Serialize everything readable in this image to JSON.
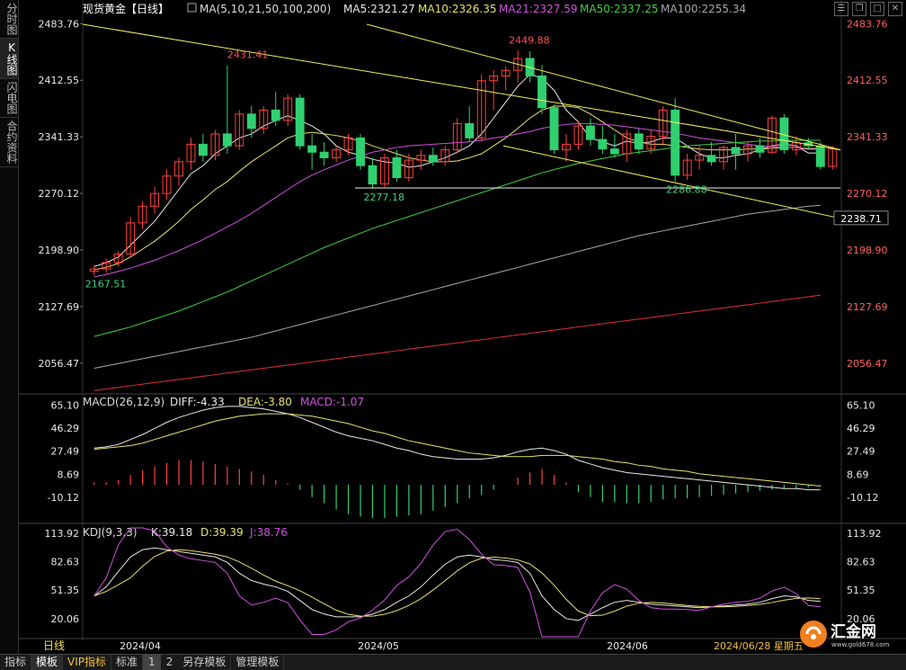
{
  "sidebar": {
    "tabs": [
      "分时图",
      "K线图",
      "闪电图",
      "合约资料"
    ],
    "active": 1
  },
  "header": {
    "title": "现货黄金【日线】",
    "lock_icon": "lock-icon"
  },
  "ma_legend": [
    {
      "label": "MA(5,10,21,50,100,200)",
      "color": "#dddddd"
    },
    {
      "label": "MA5:2321.27",
      "color": "#e8e8e8"
    },
    {
      "label": "MA10:2326.35",
      "color": "#e8e070"
    },
    {
      "label": "MA21:2327.59",
      "color": "#d050e0"
    },
    {
      "label": "MA50:2337.25",
      "color": "#40d040"
    },
    {
      "label": "MA100:2255.34",
      "color": "#a8a8a8"
    }
  ],
  "macd_legend": [
    {
      "label": "MACD(26,12,9)",
      "color": "#dddddd"
    },
    {
      "label": "DIFF:-4.33",
      "color": "#e8e8e8"
    },
    {
      "label": "DEA:-3.80",
      "color": "#e8e070"
    },
    {
      "label": "MACD:-1.07",
      "color": "#d050e0"
    }
  ],
  "kdj_legend": [
    {
      "label": "KDJ(9,3,3)",
      "color": "#dddddd"
    },
    {
      "label": "K:39.18",
      "color": "#e8e8e8"
    },
    {
      "label": "D:39.39",
      "color": "#e8e070"
    },
    {
      "label": "J:38.76",
      "color": "#d050e0"
    }
  ],
  "bottom_bar": {
    "period": "日线",
    "items": [
      "指标",
      "模板",
      "VIP指标",
      "标准",
      "1",
      "2",
      "另存模板",
      "管理模板"
    ]
  },
  "logo": {
    "name": "汇金网",
    "url": "www.gold678.com"
  },
  "chart_data": {
    "type": "candlestick",
    "price_ticks": [
      "2483.76",
      "2412.55",
      "2341.33",
      "2270.12",
      "2198.90",
      "2127.69",
      "2056.47"
    ],
    "price_range": [
      2020.0,
      2500.0
    ],
    "trendline_label": "2238.71",
    "x_labels": [
      "2024/04",
      "2024/05",
      "2024/06"
    ],
    "cursor_date": "2024/06/28 星期五",
    "annotations": [
      {
        "text": "2483.76",
        "color": "#dddddd"
      },
      {
        "text": "2431.41",
        "color": "#ff5050"
      },
      {
        "text": "2449.88",
        "color": "#ff5050"
      },
      {
        "text": "2167.51",
        "color": "#40d080"
      },
      {
        "text": "2277.18",
        "color": "#40d080"
      },
      {
        "text": "2286.88",
        "color": "#40d080"
      }
    ],
    "candles": [
      {
        "o": 2172,
        "h": 2180,
        "l": 2167,
        "c": 2175
      },
      {
        "o": 2175,
        "h": 2188,
        "l": 2170,
        "c": 2183
      },
      {
        "o": 2183,
        "h": 2198,
        "l": 2178,
        "c": 2194
      },
      {
        "o": 2194,
        "h": 2240,
        "l": 2190,
        "c": 2233
      },
      {
        "o": 2233,
        "h": 2260,
        "l": 2225,
        "c": 2254
      },
      {
        "o": 2254,
        "h": 2278,
        "l": 2245,
        "c": 2270
      },
      {
        "o": 2270,
        "h": 2300,
        "l": 2262,
        "c": 2292
      },
      {
        "o": 2292,
        "h": 2315,
        "l": 2280,
        "c": 2310
      },
      {
        "o": 2310,
        "h": 2340,
        "l": 2300,
        "c": 2332
      },
      {
        "o": 2332,
        "h": 2345,
        "l": 2310,
        "c": 2318
      },
      {
        "o": 2318,
        "h": 2350,
        "l": 2312,
        "c": 2345
      },
      {
        "o": 2345,
        "h": 2431,
        "l": 2320,
        "c": 2330
      },
      {
        "o": 2330,
        "h": 2375,
        "l": 2325,
        "c": 2370
      },
      {
        "o": 2370,
        "h": 2380,
        "l": 2340,
        "c": 2352
      },
      {
        "o": 2352,
        "h": 2380,
        "l": 2345,
        "c": 2375
      },
      {
        "o": 2375,
        "h": 2398,
        "l": 2355,
        "c": 2362
      },
      {
        "o": 2362,
        "h": 2395,
        "l": 2355,
        "c": 2390
      },
      {
        "o": 2390,
        "h": 2395,
        "l": 2325,
        "c": 2330
      },
      {
        "o": 2330,
        "h": 2345,
        "l": 2300,
        "c": 2322
      },
      {
        "o": 2322,
        "h": 2335,
        "l": 2305,
        "c": 2315
      },
      {
        "o": 2315,
        "h": 2330,
        "l": 2310,
        "c": 2325
      },
      {
        "o": 2325,
        "h": 2345,
        "l": 2318,
        "c": 2340
      },
      {
        "o": 2340,
        "h": 2345,
        "l": 2300,
        "c": 2305
      },
      {
        "o": 2305,
        "h": 2315,
        "l": 2277,
        "c": 2282
      },
      {
        "o": 2282,
        "h": 2320,
        "l": 2278,
        "c": 2315
      },
      {
        "o": 2315,
        "h": 2325,
        "l": 2285,
        "c": 2290
      },
      {
        "o": 2290,
        "h": 2320,
        "l": 2285,
        "c": 2312
      },
      {
        "o": 2312,
        "h": 2325,
        "l": 2300,
        "c": 2318
      },
      {
        "o": 2318,
        "h": 2328,
        "l": 2305,
        "c": 2310
      },
      {
        "o": 2310,
        "h": 2330,
        "l": 2305,
        "c": 2325
      },
      {
        "o": 2325,
        "h": 2365,
        "l": 2320,
        "c": 2358
      },
      {
        "o": 2358,
        "h": 2380,
        "l": 2335,
        "c": 2340
      },
      {
        "o": 2340,
        "h": 2420,
        "l": 2335,
        "c": 2412
      },
      {
        "o": 2412,
        "h": 2425,
        "l": 2375,
        "c": 2418
      },
      {
        "o": 2418,
        "h": 2430,
        "l": 2400,
        "c": 2425
      },
      {
        "o": 2425,
        "h": 2450,
        "l": 2410,
        "c": 2440
      },
      {
        "o": 2440,
        "h": 2449,
        "l": 2410,
        "c": 2418
      },
      {
        "o": 2418,
        "h": 2432,
        "l": 2370,
        "c": 2378
      },
      {
        "o": 2378,
        "h": 2382,
        "l": 2320,
        "c": 2325
      },
      {
        "o": 2325,
        "h": 2345,
        "l": 2310,
        "c": 2332
      },
      {
        "o": 2332,
        "h": 2360,
        "l": 2325,
        "c": 2355
      },
      {
        "o": 2355,
        "h": 2365,
        "l": 2330,
        "c": 2338
      },
      {
        "o": 2338,
        "h": 2355,
        "l": 2320,
        "c": 2326
      },
      {
        "o": 2326,
        "h": 2345,
        "l": 2315,
        "c": 2320
      },
      {
        "o": 2320,
        "h": 2350,
        "l": 2310,
        "c": 2345
      },
      {
        "o": 2345,
        "h": 2352,
        "l": 2320,
        "c": 2326
      },
      {
        "o": 2326,
        "h": 2350,
        "l": 2320,
        "c": 2342
      },
      {
        "o": 2342,
        "h": 2380,
        "l": 2330,
        "c": 2375
      },
      {
        "o": 2375,
        "h": 2390,
        "l": 2285,
        "c": 2293
      },
      {
        "o": 2293,
        "h": 2320,
        "l": 2287,
        "c": 2312
      },
      {
        "o": 2312,
        "h": 2330,
        "l": 2300,
        "c": 2318
      },
      {
        "o": 2318,
        "h": 2335,
        "l": 2305,
        "c": 2310
      },
      {
        "o": 2310,
        "h": 2330,
        "l": 2300,
        "c": 2328
      },
      {
        "o": 2328,
        "h": 2345,
        "l": 2300,
        "c": 2320
      },
      {
        "o": 2320,
        "h": 2335,
        "l": 2310,
        "c": 2330
      },
      {
        "o": 2330,
        "h": 2340,
        "l": 2315,
        "c": 2322
      },
      {
        "o": 2322,
        "h": 2368,
        "l": 2320,
        "c": 2365
      },
      {
        "o": 2365,
        "h": 2370,
        "l": 2320,
        "c": 2325
      },
      {
        "o": 2325,
        "h": 2342,
        "l": 2318,
        "c": 2334
      },
      {
        "o": 2334,
        "h": 2340,
        "l": 2325,
        "c": 2330
      },
      {
        "o": 2330,
        "h": 2335,
        "l": 2300,
        "c": 2304
      },
      {
        "o": 2304,
        "h": 2330,
        "l": 2300,
        "c": 2326
      }
    ],
    "ma_lines": [
      {
        "name": "MA5",
        "color": "#e8e8e8",
        "values": [
          2178,
          2183,
          2190,
          2205,
          2220,
          2235,
          2255,
          2275,
          2295,
          2305,
          2320,
          2330,
          2340,
          2345,
          2355,
          2362,
          2368,
          2362,
          2355,
          2345,
          2330,
          2322,
          2318,
          2313,
          2310,
          2308,
          2303,
          2305,
          2310,
          2315,
          2322,
          2330,
          2345,
          2365,
          2385,
          2405,
          2420,
          2415,
          2400,
          2375,
          2360,
          2340,
          2335,
          2330,
          2336,
          2333,
          2335,
          2340,
          2340,
          2330,
          2320,
          2315,
          2315,
          2318,
          2320,
          2325,
          2330,
          2332,
          2330,
          2321,
          2321
        ]
      },
      {
        "name": "MA10",
        "color": "#e8e070",
        "values": [
          2174,
          2177,
          2182,
          2190,
          2200,
          2210,
          2222,
          2235,
          2250,
          2262,
          2275,
          2285,
          2298,
          2310,
          2320,
          2330,
          2340,
          2345,
          2347,
          2345,
          2343,
          2340,
          2336,
          2330,
          2325,
          2320,
          2315,
          2312,
          2310,
          2310,
          2311,
          2315,
          2320,
          2330,
          2340,
          2352,
          2365,
          2375,
          2380,
          2380,
          2378,
          2370,
          2360,
          2350,
          2340,
          2335,
          2332,
          2332,
          2330,
          2328,
          2326,
          2325,
          2325,
          2325,
          2326,
          2326,
          2327,
          2328,
          2328,
          2326,
          2326
        ]
      },
      {
        "name": "MA21",
        "color": "#d050e0",
        "values": [
          2165,
          2168,
          2172,
          2176,
          2181,
          2186,
          2192,
          2198,
          2205,
          2212,
          2220,
          2228,
          2236,
          2245,
          2255,
          2265,
          2275,
          2285,
          2293,
          2300,
          2306,
          2312,
          2317,
          2322,
          2325,
          2328,
          2330,
          2331,
          2332,
          2333,
          2334,
          2335,
          2337,
          2340,
          2342,
          2345,
          2348,
          2352,
          2355,
          2357,
          2358,
          2358,
          2357,
          2356,
          2354,
          2352,
          2350,
          2348,
          2346,
          2343,
          2340,
          2338,
          2336,
          2334,
          2332,
          2330,
          2329,
          2328,
          2328,
          2327,
          2327
        ]
      },
      {
        "name": "MA50",
        "color": "#40d040",
        "values": [
          2090,
          2094,
          2098,
          2102,
          2107,
          2112,
          2117,
          2122,
          2128,
          2134,
          2140,
          2146,
          2153,
          2160,
          2167,
          2174,
          2181,
          2188,
          2195,
          2202,
          2208,
          2214,
          2220,
          2226,
          2231,
          2236,
          2241,
          2246,
          2251,
          2256,
          2261,
          2266,
          2271,
          2276,
          2281,
          2286,
          2291,
          2296,
          2300,
          2304,
          2308,
          2311,
          2314,
          2317,
          2320,
          2322,
          2324,
          2326,
          2328,
          2330,
          2331,
          2332,
          2333,
          2334,
          2335,
          2336,
          2336,
          2337,
          2337,
          2337,
          2337
        ]
      },
      {
        "name": "MA100",
        "color": "#a8a8a8",
        "values": [
          2050,
          2053,
          2056,
          2059,
          2062,
          2065,
          2068,
          2071,
          2074,
          2077,
          2080,
          2083,
          2086,
          2089,
          2093,
          2097,
          2101,
          2105,
          2109,
          2113,
          2117,
          2121,
          2125,
          2129,
          2133,
          2137,
          2141,
          2145,
          2149,
          2153,
          2157,
          2161,
          2165,
          2169,
          2173,
          2177,
          2181,
          2185,
          2189,
          2193,
          2197,
          2201,
          2205,
          2209,
          2213,
          2217,
          2220,
          2223,
          2226,
          2229,
          2232,
          2235,
          2238,
          2241,
          2244,
          2246,
          2248,
          2250,
          2252,
          2254,
          2255
        ]
      },
      {
        "name": "MA200",
        "color": "#e03030",
        "values": [
          2022,
          2024,
          2026,
          2028,
          2030,
          2032,
          2034,
          2036,
          2038,
          2040,
          2042,
          2044,
          2046,
          2048,
          2050,
          2052,
          2054,
          2056,
          2058,
          2060,
          2062,
          2064,
          2066,
          2068,
          2070,
          2072,
          2074,
          2076,
          2078,
          2080,
          2082,
          2084,
          2086,
          2088,
          2090,
          2092,
          2094,
          2096,
          2098,
          2100,
          2102,
          2104,
          2106,
          2108,
          2110,
          2112,
          2114,
          2116,
          2118,
          2120,
          2122,
          2124,
          2126,
          2128,
          2130,
          2132,
          2134,
          2136,
          2138,
          2140,
          2142
        ]
      }
    ],
    "macd": {
      "ticks": [
        "65.10",
        "46.29",
        "27.49",
        "8.69",
        "-10.12"
      ],
      "range": [
        -30,
        72
      ],
      "diff": [
        30,
        31,
        33,
        37,
        41,
        46,
        51,
        55,
        58,
        61,
        63,
        64,
        64,
        63,
        62,
        60,
        58,
        55,
        51,
        47,
        43,
        40,
        38,
        36,
        33,
        30,
        28,
        25,
        23,
        22,
        21,
        21,
        21,
        22,
        24,
        27,
        29,
        30,
        28,
        25,
        20,
        17,
        14,
        12,
        10,
        9,
        8,
        7,
        6,
        5,
        4,
        3,
        2,
        1,
        0,
        -1,
        -2,
        -3,
        -3,
        -4,
        -4
      ],
      "dea": [
        29,
        30,
        31,
        32,
        34,
        37,
        40,
        43,
        46,
        49,
        52,
        54,
        56,
        57,
        58,
        58,
        58,
        57,
        56,
        54,
        52,
        50,
        47,
        44,
        42,
        39,
        36,
        34,
        32,
        30,
        28,
        26,
        25,
        24,
        23,
        23,
        23,
        24,
        24,
        24,
        23,
        22,
        21,
        19,
        18,
        16,
        15,
        13,
        12,
        11,
        9,
        8,
        7,
        6,
        5,
        4,
        3,
        2,
        1,
        0,
        -1
      ],
      "hist": [
        2,
        2,
        4,
        8,
        12,
        15,
        18,
        20,
        20,
        19,
        17,
        15,
        13,
        11,
        8,
        4,
        1,
        -4,
        -10,
        -15,
        -20,
        -24,
        -26,
        -27,
        -27,
        -26,
        -25,
        -24,
        -21,
        -18,
        -15,
        -11,
        -8,
        -4,
        0,
        6,
        10,
        13,
        8,
        2,
        -6,
        -10,
        -14,
        -14,
        -15,
        -15,
        -14,
        -12,
        -11,
        -11,
        -10,
        -9,
        -8,
        -7,
        -6,
        -5,
        -4,
        -3,
        -3,
        -2,
        -1
      ]
    },
    "kdj": {
      "ticks": [
        "113.92",
        "82.63",
        "51.35",
        "20.06"
      ],
      "range": [
        0,
        122
      ],
      "k": [
        45,
        55,
        72,
        88,
        96,
        98,
        96,
        94,
        92,
        90,
        88,
        82,
        70,
        62,
        58,
        55,
        50,
        40,
        30,
        25,
        22,
        22,
        22,
        25,
        30,
        38,
        45,
        55,
        68,
        80,
        88,
        90,
        88,
        85,
        84,
        82,
        70,
        45,
        30,
        20,
        18,
        25,
        32,
        38,
        40,
        38,
        36,
        35,
        34,
        33,
        32,
        33,
        34,
        35,
        36,
        38,
        42,
        45,
        44,
        40,
        39
      ]
    }
  }
}
